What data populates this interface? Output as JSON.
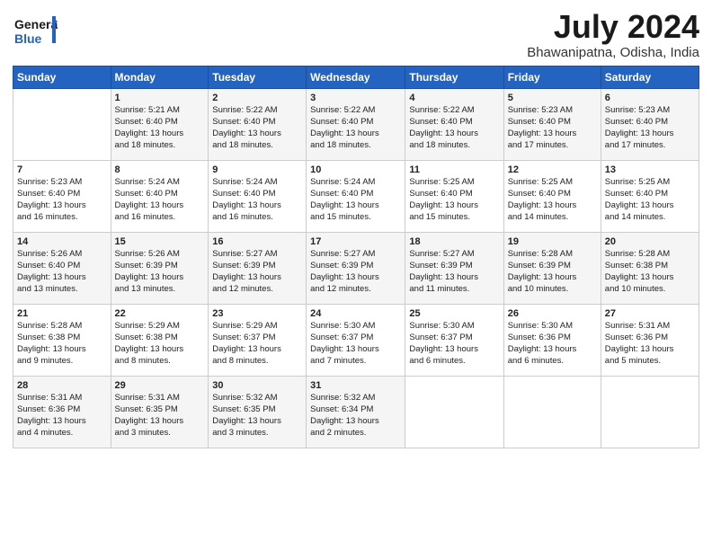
{
  "logo": {
    "line1": "General",
    "line2": "Blue"
  },
  "title": "July 2024",
  "subtitle": "Bhawanipatna, Odisha, India",
  "days_of_week": [
    "Sunday",
    "Monday",
    "Tuesday",
    "Wednesday",
    "Thursday",
    "Friday",
    "Saturday"
  ],
  "weeks": [
    [
      {
        "day": "",
        "content": ""
      },
      {
        "day": "1",
        "content": "Sunrise: 5:21 AM\nSunset: 6:40 PM\nDaylight: 13 hours\nand 18 minutes."
      },
      {
        "day": "2",
        "content": "Sunrise: 5:22 AM\nSunset: 6:40 PM\nDaylight: 13 hours\nand 18 minutes."
      },
      {
        "day": "3",
        "content": "Sunrise: 5:22 AM\nSunset: 6:40 PM\nDaylight: 13 hours\nand 18 minutes."
      },
      {
        "day": "4",
        "content": "Sunrise: 5:22 AM\nSunset: 6:40 PM\nDaylight: 13 hours\nand 18 minutes."
      },
      {
        "day": "5",
        "content": "Sunrise: 5:23 AM\nSunset: 6:40 PM\nDaylight: 13 hours\nand 17 minutes."
      },
      {
        "day": "6",
        "content": "Sunrise: 5:23 AM\nSunset: 6:40 PM\nDaylight: 13 hours\nand 17 minutes."
      }
    ],
    [
      {
        "day": "7",
        "content": "Sunrise: 5:23 AM\nSunset: 6:40 PM\nDaylight: 13 hours\nand 16 minutes."
      },
      {
        "day": "8",
        "content": "Sunrise: 5:24 AM\nSunset: 6:40 PM\nDaylight: 13 hours\nand 16 minutes."
      },
      {
        "day": "9",
        "content": "Sunrise: 5:24 AM\nSunset: 6:40 PM\nDaylight: 13 hours\nand 16 minutes."
      },
      {
        "day": "10",
        "content": "Sunrise: 5:24 AM\nSunset: 6:40 PM\nDaylight: 13 hours\nand 15 minutes."
      },
      {
        "day": "11",
        "content": "Sunrise: 5:25 AM\nSunset: 6:40 PM\nDaylight: 13 hours\nand 15 minutes."
      },
      {
        "day": "12",
        "content": "Sunrise: 5:25 AM\nSunset: 6:40 PM\nDaylight: 13 hours\nand 14 minutes."
      },
      {
        "day": "13",
        "content": "Sunrise: 5:25 AM\nSunset: 6:40 PM\nDaylight: 13 hours\nand 14 minutes."
      }
    ],
    [
      {
        "day": "14",
        "content": "Sunrise: 5:26 AM\nSunset: 6:40 PM\nDaylight: 13 hours\nand 13 minutes."
      },
      {
        "day": "15",
        "content": "Sunrise: 5:26 AM\nSunset: 6:39 PM\nDaylight: 13 hours\nand 13 minutes."
      },
      {
        "day": "16",
        "content": "Sunrise: 5:27 AM\nSunset: 6:39 PM\nDaylight: 13 hours\nand 12 minutes."
      },
      {
        "day": "17",
        "content": "Sunrise: 5:27 AM\nSunset: 6:39 PM\nDaylight: 13 hours\nand 12 minutes."
      },
      {
        "day": "18",
        "content": "Sunrise: 5:27 AM\nSunset: 6:39 PM\nDaylight: 13 hours\nand 11 minutes."
      },
      {
        "day": "19",
        "content": "Sunrise: 5:28 AM\nSunset: 6:39 PM\nDaylight: 13 hours\nand 10 minutes."
      },
      {
        "day": "20",
        "content": "Sunrise: 5:28 AM\nSunset: 6:38 PM\nDaylight: 13 hours\nand 10 minutes."
      }
    ],
    [
      {
        "day": "21",
        "content": "Sunrise: 5:28 AM\nSunset: 6:38 PM\nDaylight: 13 hours\nand 9 minutes."
      },
      {
        "day": "22",
        "content": "Sunrise: 5:29 AM\nSunset: 6:38 PM\nDaylight: 13 hours\nand 8 minutes."
      },
      {
        "day": "23",
        "content": "Sunrise: 5:29 AM\nSunset: 6:37 PM\nDaylight: 13 hours\nand 8 minutes."
      },
      {
        "day": "24",
        "content": "Sunrise: 5:30 AM\nSunset: 6:37 PM\nDaylight: 13 hours\nand 7 minutes."
      },
      {
        "day": "25",
        "content": "Sunrise: 5:30 AM\nSunset: 6:37 PM\nDaylight: 13 hours\nand 6 minutes."
      },
      {
        "day": "26",
        "content": "Sunrise: 5:30 AM\nSunset: 6:36 PM\nDaylight: 13 hours\nand 6 minutes."
      },
      {
        "day": "27",
        "content": "Sunrise: 5:31 AM\nSunset: 6:36 PM\nDaylight: 13 hours\nand 5 minutes."
      }
    ],
    [
      {
        "day": "28",
        "content": "Sunrise: 5:31 AM\nSunset: 6:36 PM\nDaylight: 13 hours\nand 4 minutes."
      },
      {
        "day": "29",
        "content": "Sunrise: 5:31 AM\nSunset: 6:35 PM\nDaylight: 13 hours\nand 3 minutes."
      },
      {
        "day": "30",
        "content": "Sunrise: 5:32 AM\nSunset: 6:35 PM\nDaylight: 13 hours\nand 3 minutes."
      },
      {
        "day": "31",
        "content": "Sunrise: 5:32 AM\nSunset: 6:34 PM\nDaylight: 13 hours\nand 2 minutes."
      },
      {
        "day": "",
        "content": ""
      },
      {
        "day": "",
        "content": ""
      },
      {
        "day": "",
        "content": ""
      }
    ]
  ]
}
